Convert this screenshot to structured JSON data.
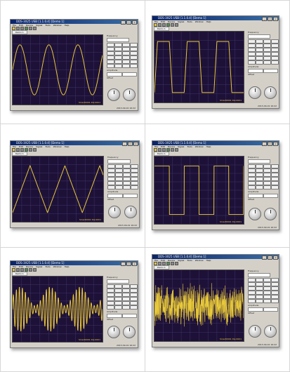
{
  "colors": {
    "screen_bg": "#1e1138",
    "grid": "#3d3566",
    "trace": "#e8c93a",
    "title_bar": "#0a246a",
    "window_face": "#d4d0c8"
  },
  "panels": [
    {
      "id": 1,
      "title": "DDS-3X25 USB [1.1.0.4]  [Demo 1]",
      "signal": "sine",
      "status": "Smart0001  Dis:0001",
      "date": "2013-09-01 16:22"
    },
    {
      "id": 2,
      "title": "DDS-3X25 USB [1.1.0.4]  [Demo 1]",
      "signal": "trapezoid",
      "status": "Smart0001  Dis:0001",
      "date": "2013-09-01 16:22"
    },
    {
      "id": 3,
      "title": "DDS-3X25 USB [1.1.0.4]  [Demo 1]",
      "signal": "triangle",
      "status": "Smart0001  Dis:0001",
      "date": "2013-09-01 16:22"
    },
    {
      "id": 4,
      "title": "DDS-3X25 USB [1.1.0.4]  [Demo 1]",
      "signal": "square",
      "status": "Smart0001  Dis:0001",
      "date": "2013-09-01 16:22"
    },
    {
      "id": 5,
      "title": "DDS-3X25 USB [1.1.0.4]  [Demo 1]",
      "signal": "am_modulated",
      "status": "Smart0001  Dis:0001",
      "date": "2013-09-01 16:22"
    },
    {
      "id": 6,
      "title": "DDS-3X25 USB [1.1.0.4]  [Demo 1]",
      "signal": "noise",
      "status": "Smart0001  Dis:0001",
      "date": "2013-09-01 16:22"
    }
  ],
  "menu": [
    "File",
    "Edit",
    "Device",
    "Signal",
    "Tools",
    "Window",
    "Help"
  ],
  "subtab_label": "Demo 1",
  "labels": {
    "frequency": "Frequency",
    "amplitude": "Amplitude",
    "offset": "Offset",
    "freq_value": "1.000 kHz",
    "amp_value": "5.00V",
    "wave": "Wave"
  },
  "icons": [
    "new-icon",
    "open-icon",
    "save-icon",
    "run-icon",
    "stop-icon",
    "settings-icon"
  ]
}
